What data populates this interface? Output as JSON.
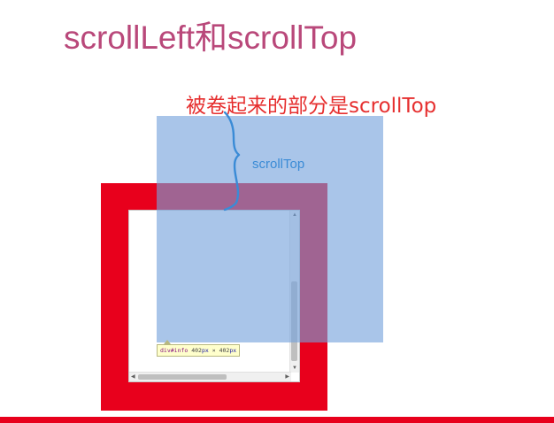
{
  "slide": {
    "title": "scrollLeft和scrollTop",
    "caption": "被卷起来的部分是scrollTop"
  },
  "diagram": {
    "brace_label": "scrollTop",
    "tooltip": {
      "tag": "div#info",
      "width_text": "402",
      "height_text": "402",
      "unit": "px",
      "separator": " × "
    }
  },
  "colors": {
    "title": "#b9487a",
    "caption": "#e62f2f",
    "frame": "#e8001c",
    "content_overlay": "#74a2dc",
    "brace": "#3a8bd6",
    "bottom_rule": "#e8001c"
  },
  "icons": {
    "scroll_up": "triangle-up",
    "scroll_down": "triangle-down",
    "scroll_left": "triangle-left",
    "scroll_right": "triangle-right"
  }
}
